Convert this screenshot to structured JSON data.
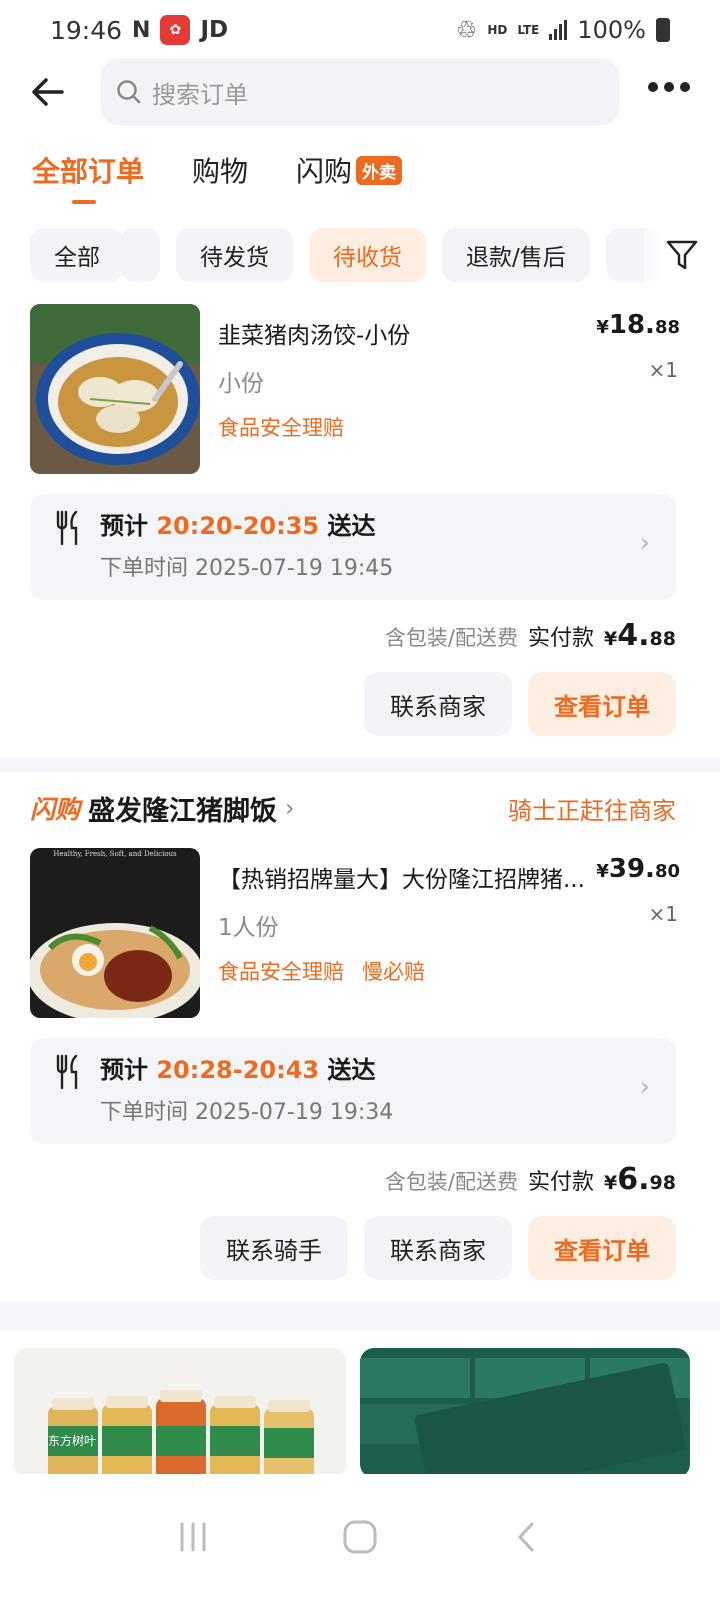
{
  "status_bar": {
    "time": "19:46",
    "nfc": "N",
    "app_icon_text": "",
    "carrier_text": "JD",
    "hd_label": "HD",
    "lte_label": "LTE",
    "battery": "100%"
  },
  "header": {
    "search_placeholder": "搜索订单"
  },
  "top_tabs": [
    {
      "label": "全部订单",
      "active": true
    },
    {
      "label": "购物",
      "active": false
    },
    {
      "label": "闪购",
      "badge": "外卖",
      "active": false
    }
  ],
  "filters": [
    {
      "label": "全部",
      "active": false
    },
    {
      "label": "",
      "active": false
    },
    {
      "label": "待发货",
      "active": false
    },
    {
      "label": "待收货",
      "active": true
    },
    {
      "label": "退款/售后",
      "active": false
    },
    {
      "label": "",
      "active": false
    }
  ],
  "orders": [
    {
      "item_title": "韭菜猪肉汤饺-小份",
      "item_spec": "小份",
      "tags": [
        "食品安全理赔"
      ],
      "price_symbol": "¥",
      "price_main": "18.",
      "price_decimal": "88",
      "quantity": "×1",
      "eta_prefix": "预计",
      "eta_time": "20:20-20:35",
      "eta_suffix": "送达",
      "order_time": "下单时间 2025-07-19 19:45",
      "pay_note": "含包装/配送费",
      "pay_label": "实付款",
      "pay_symbol": "¥",
      "pay_main": "4.",
      "pay_decimal": "88",
      "buttons": [
        "联系商家",
        "查看订单"
      ]
    },
    {
      "brand": "闪购",
      "shop_name": "盛发隆江猪脚饭",
      "shop_status": "骑士正赶往商家",
      "thumb_overlay": "Healthy, Fresh, Soft, and Delicious",
      "item_title": "【热销招牌量大】大份隆江招牌猪...",
      "item_spec": "1人份",
      "tags": [
        "食品安全理赔",
        "慢必赔"
      ],
      "price_symbol": "¥",
      "price_main": "39.",
      "price_decimal": "80",
      "quantity": "×1",
      "eta_prefix": "预计",
      "eta_time": "20:28-20:43",
      "eta_suffix": "送达",
      "order_time": "下单时间 2025-07-19 19:34",
      "pay_note": "含包装/配送费",
      "pay_label": "实付款",
      "pay_symbol": "¥",
      "pay_main": "6.",
      "pay_decimal": "98",
      "buttons": [
        "联系骑手",
        "联系商家",
        "查看订单"
      ]
    }
  ],
  "recommendations": {
    "left_label": "东方树叶",
    "right_label": ""
  },
  "colors": {
    "accent": "#ee6a1e",
    "accent_bg": "#fdeee1",
    "chip_bg": "#f2f4f7",
    "text": "#1a1a1a",
    "muted": "#8a8a8a"
  }
}
